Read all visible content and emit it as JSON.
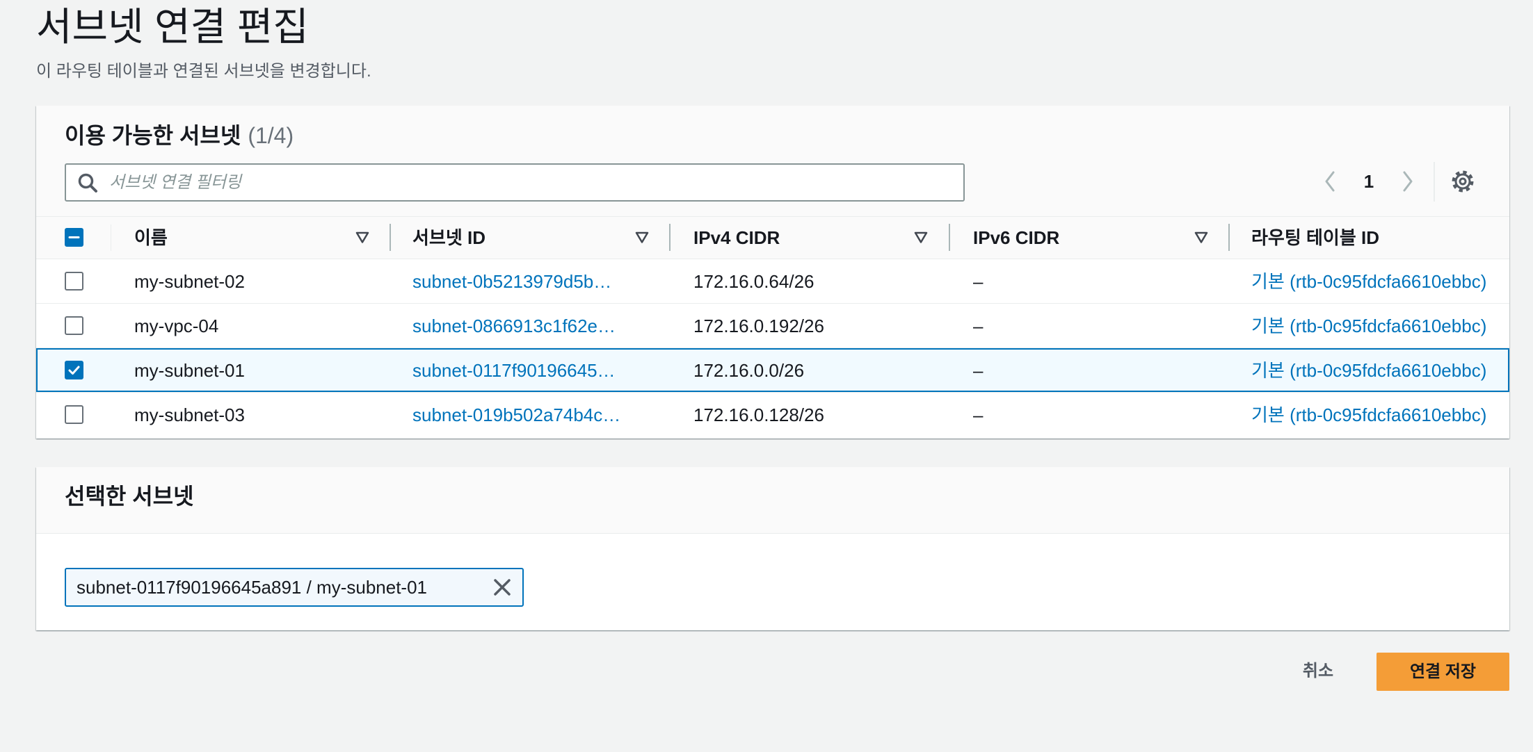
{
  "page": {
    "title": "서브넷 연결 편집",
    "description": "이 라우팅 테이블과 연결된 서브넷을 변경합니다."
  },
  "available_subnets": {
    "heading": "이용 가능한 서브넷",
    "count": "(1/4)",
    "filter": {
      "placeholder": "서브넷 연결 필터링"
    },
    "pagination": {
      "current_page": "1"
    },
    "select_all": {
      "checked": false,
      "indeterminate": true
    },
    "columns": [
      {
        "label": "이름"
      },
      {
        "label": "서브넷 ID"
      },
      {
        "label": "IPv4 CIDR"
      },
      {
        "label": "IPv6 CIDR"
      },
      {
        "label": "라우팅 테이블 ID"
      }
    ],
    "rows": [
      {
        "name": "my-subnet-02",
        "subnet_id": "subnet-0b5213979d5b…",
        "ipv4_cidr": "172.16.0.64/26",
        "ipv6_cidr": "–",
        "route_table_id": "기본 (rtb-0c95fdcfa6610ebbc)",
        "selected": false
      },
      {
        "name": "my-vpc-04",
        "subnet_id": "subnet-0866913c1f62e…",
        "ipv4_cidr": "172.16.0.192/26",
        "ipv6_cidr": "–",
        "route_table_id": "기본 (rtb-0c95fdcfa6610ebbc)",
        "selected": false
      },
      {
        "name": "my-subnet-01",
        "subnet_id": "subnet-0117f90196645…",
        "ipv4_cidr": "172.16.0.0/26",
        "ipv6_cidr": "–",
        "route_table_id": "기본 (rtb-0c95fdcfa6610ebbc)",
        "selected": true
      },
      {
        "name": "my-subnet-03",
        "subnet_id": "subnet-019b502a74b4c…",
        "ipv4_cidr": "172.16.0.128/26",
        "ipv6_cidr": "–",
        "route_table_id": "기본 (rtb-0c95fdcfa6610ebbc)",
        "selected": false
      }
    ]
  },
  "selected_subnets": {
    "heading": "선택한 서브넷",
    "tokens": [
      {
        "label": "subnet-0117f90196645a891 / my-subnet-01"
      }
    ]
  },
  "actions": {
    "cancel_label": "취소",
    "save_label": "연결 저장"
  },
  "colors": {
    "link": "#0073bb",
    "primary_button": "#f49d37",
    "page_background": "#f2f3f3",
    "selected_row_background": "#f1faff",
    "token_background": "#f2f8fd"
  },
  "icons": {
    "search": "search-icon",
    "previous_page": "chevron-left-icon",
    "next_page": "chevron-right-icon",
    "preferences": "gear-icon",
    "column_sort": "sort-icon",
    "remove_token": "close-icon",
    "checkbox_checked": "check-icon",
    "checkbox_indeterminate": "dash-icon"
  }
}
